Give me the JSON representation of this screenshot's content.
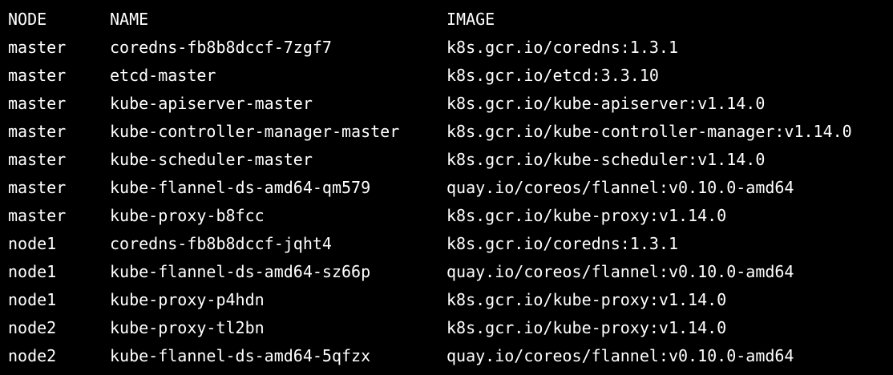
{
  "terminal": {
    "headers": {
      "node": "NODE",
      "name": "NAME",
      "image": "IMAGE"
    },
    "rows": [
      {
        "node": "master",
        "name": "coredns-fb8b8dccf-7zgf7",
        "image": "k8s.gcr.io/coredns:1.3.1"
      },
      {
        "node": "master",
        "name": "etcd-master",
        "image": "k8s.gcr.io/etcd:3.3.10"
      },
      {
        "node": "master",
        "name": "kube-apiserver-master",
        "image": "k8s.gcr.io/kube-apiserver:v1.14.0"
      },
      {
        "node": "master",
        "name": "kube-controller-manager-master",
        "image": "k8s.gcr.io/kube-controller-manager:v1.14.0"
      },
      {
        "node": "master",
        "name": "kube-scheduler-master",
        "image": "k8s.gcr.io/kube-scheduler:v1.14.0"
      },
      {
        "node": "master",
        "name": "kube-flannel-ds-amd64-qm579",
        "image": "quay.io/coreos/flannel:v0.10.0-amd64"
      },
      {
        "node": "master",
        "name": "kube-proxy-b8fcc",
        "image": "k8s.gcr.io/kube-proxy:v1.14.0"
      },
      {
        "node": "node1",
        "name": "coredns-fb8b8dccf-jqht4",
        "image": "k8s.gcr.io/coredns:1.3.1"
      },
      {
        "node": "node1",
        "name": "kube-flannel-ds-amd64-sz66p",
        "image": "quay.io/coreos/flannel:v0.10.0-amd64"
      },
      {
        "node": "node1",
        "name": "kube-proxy-p4hdn",
        "image": "k8s.gcr.io/kube-proxy:v1.14.0"
      },
      {
        "node": "node2",
        "name": "kube-proxy-tl2bn",
        "image": "k8s.gcr.io/kube-proxy:v1.14.0"
      },
      {
        "node": "node2",
        "name": "kube-flannel-ds-amd64-5qfzx",
        "image": "quay.io/coreos/flannel:v0.10.0-amd64"
      }
    ],
    "colors": {
      "background": "#000000",
      "text": "#ffffff"
    }
  }
}
